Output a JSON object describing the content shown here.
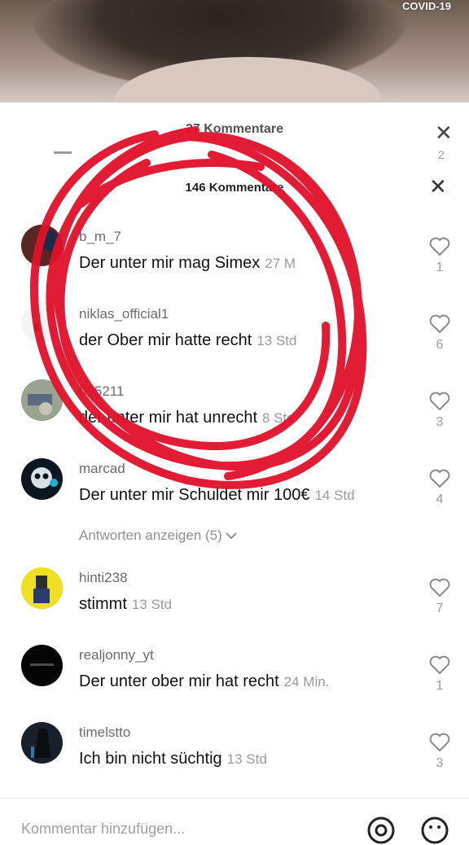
{
  "video": {
    "badge": "COVID-19"
  },
  "ghost_header": {
    "title": "27 Kommentare",
    "count": "2"
  },
  "header": {
    "title": "146 Kommentare",
    "close_glyph": "✕"
  },
  "comments": [
    {
      "user": "b_m_7",
      "text": "Der unter mir mag Simex",
      "time": "27 M",
      "likes": "1",
      "avatar_color": "#6a2f2a"
    },
    {
      "user": "niklas_official1",
      "text": "der Ober mir hatte recht",
      "time": "13 Std",
      "likes": "6",
      "avatar_color": "#ffffff"
    },
    {
      "user": "095211",
      "text": "der unter mir hat unrecht",
      "time": "8 Std",
      "likes": "3",
      "avatar_color": "#8a9a86"
    },
    {
      "user": "marcad",
      "text": "Der unter mir Schuldet mir 100€",
      "time": "14 Std",
      "likes": "4",
      "avatar_color": "#0d1a24"
    },
    {
      "user": "hinti238",
      "text": "stimmt",
      "time": "13 Std",
      "likes": "7",
      "avatar_color": "#e8d51a"
    },
    {
      "user": "realjonny_yt",
      "text": "Der unter ober mir hat recht",
      "time": "24 Min.",
      "likes": "1",
      "avatar_color": "#050505"
    },
    {
      "user": "timelstto",
      "text": "Ich bin nicht süchtig",
      "time": "13 Std",
      "likes": "3",
      "avatar_color": "#1d2430"
    }
  ],
  "replies_link": "Antworten anzeigen (5)",
  "input": {
    "placeholder": "Kommentar hinzufügen..."
  },
  "icons": {
    "heart": "heart-outline-icon",
    "at": "at-mention-icon",
    "emoji": "emoji-icon",
    "close": "close-icon"
  },
  "colors": {
    "scribble": "#e0102a",
    "text_muted": "#9a9a9a"
  }
}
